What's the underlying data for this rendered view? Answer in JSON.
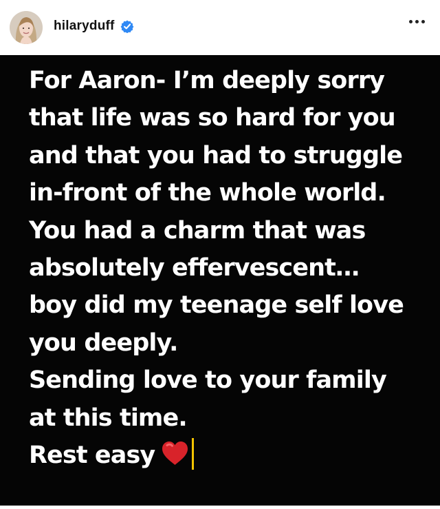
{
  "header": {
    "username": "hilaryduff",
    "verified": true,
    "avatar_icon": "profile-avatar",
    "more_icon": "more-options-icon"
  },
  "post": {
    "background_color": "#050505",
    "text_color": "#ffffff",
    "lines": [
      "For Aaron- I’m deeply sorry",
      "that life was so hard for you",
      "and that you had to struggle",
      "in-front of the whole world.",
      "You had a charm that was",
      "absolutely effervescent…",
      "boy did my teenage self love",
      "you deeply.",
      "Sending love to your family",
      "at this time.",
      "Rest easy"
    ],
    "emoji": "heart-emoji",
    "emoji_color": "#d8232a",
    "cursor_color": "#f5c400"
  }
}
